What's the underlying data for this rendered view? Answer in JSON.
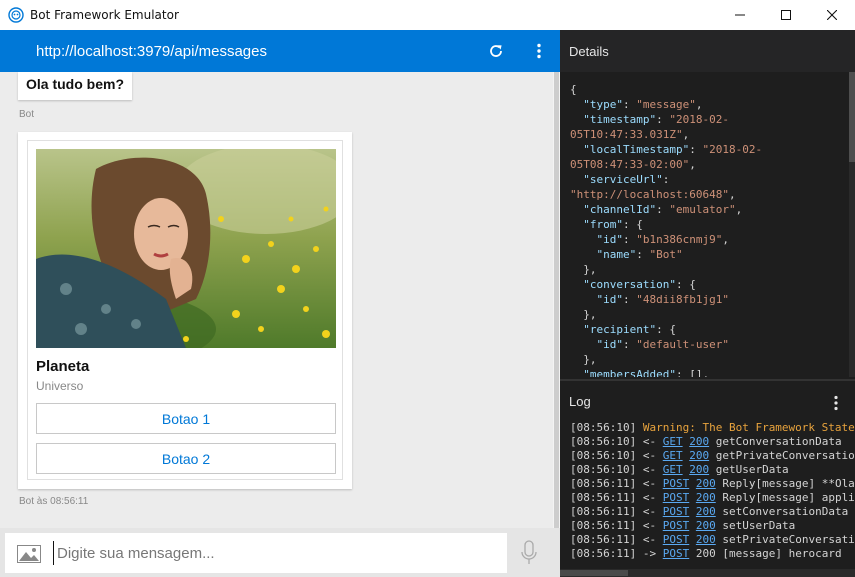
{
  "window": {
    "title": "Bot Framework Emulator"
  },
  "chat": {
    "endpoint": "http://localhost:3979/api/messages",
    "messages": [
      {
        "text": "Ola tudo bem?",
        "meta": "Bot"
      }
    ],
    "card": {
      "title": "Planeta",
      "subtitle": "Universo",
      "buttons": [
        "Botao 1",
        "Botao 2"
      ],
      "meta": "Bot às 08:56:11"
    },
    "input": {
      "placeholder": "Digite sua mensagem..."
    }
  },
  "details": {
    "title": "Details",
    "json_lines": [
      {
        "t": [
          [
            "p",
            "{"
          ]
        ]
      },
      {
        "t": [
          [
            "p",
            "  "
          ],
          [
            "k",
            "\"type\""
          ],
          [
            "p",
            ": "
          ],
          [
            "s",
            "\"message\""
          ],
          [
            "p",
            ","
          ]
        ]
      },
      {
        "t": [
          [
            "p",
            "  "
          ],
          [
            "k",
            "\"timestamp\""
          ],
          [
            "p",
            ": "
          ],
          [
            "s",
            "\"2018-02-"
          ]
        ]
      },
      {
        "t": [
          [
            "s",
            "05T10:47:33.031Z\""
          ],
          [
            "p",
            ","
          ]
        ]
      },
      {
        "t": [
          [
            "p",
            "  "
          ],
          [
            "k",
            "\"localTimestamp\""
          ],
          [
            "p",
            ": "
          ],
          [
            "s",
            "\"2018-02-"
          ]
        ]
      },
      {
        "t": [
          [
            "s",
            "05T08:47:33-02:00\""
          ],
          [
            "p",
            ","
          ]
        ]
      },
      {
        "t": [
          [
            "p",
            "  "
          ],
          [
            "k",
            "\"serviceUrl\""
          ],
          [
            "p",
            ":"
          ]
        ]
      },
      {
        "t": [
          [
            "s",
            "\"http://localhost:60648\""
          ],
          [
            "p",
            ","
          ]
        ]
      },
      {
        "t": [
          [
            "p",
            "  "
          ],
          [
            "k",
            "\"channelId\""
          ],
          [
            "p",
            ": "
          ],
          [
            "s",
            "\"emulator\""
          ],
          [
            "p",
            ","
          ]
        ]
      },
      {
        "t": [
          [
            "p",
            "  "
          ],
          [
            "k",
            "\"from\""
          ],
          [
            "p",
            ": {"
          ]
        ]
      },
      {
        "t": [
          [
            "p",
            "    "
          ],
          [
            "k",
            "\"id\""
          ],
          [
            "p",
            ": "
          ],
          [
            "s",
            "\"b1n386cnmj9\""
          ],
          [
            "p",
            ","
          ]
        ]
      },
      {
        "t": [
          [
            "p",
            "    "
          ],
          [
            "k",
            "\"name\""
          ],
          [
            "p",
            ": "
          ],
          [
            "s",
            "\"Bot\""
          ]
        ]
      },
      {
        "t": [
          [
            "p",
            "  },"
          ]
        ]
      },
      {
        "t": [
          [
            "p",
            "  "
          ],
          [
            "k",
            "\"conversation\""
          ],
          [
            "p",
            ": {"
          ]
        ]
      },
      {
        "t": [
          [
            "p",
            "    "
          ],
          [
            "k",
            "\"id\""
          ],
          [
            "p",
            ": "
          ],
          [
            "s",
            "\"48dii8fb1jg1\""
          ]
        ]
      },
      {
        "t": [
          [
            "p",
            "  },"
          ]
        ]
      },
      {
        "t": [
          [
            "p",
            "  "
          ],
          [
            "k",
            "\"recipient\""
          ],
          [
            "p",
            ": {"
          ]
        ]
      },
      {
        "t": [
          [
            "p",
            "    "
          ],
          [
            "k",
            "\"id\""
          ],
          [
            "p",
            ": "
          ],
          [
            "s",
            "\"default-user\""
          ]
        ]
      },
      {
        "t": [
          [
            "p",
            "  },"
          ]
        ]
      },
      {
        "t": [
          [
            "p",
            "  "
          ],
          [
            "k",
            "\"membersAdded\""
          ],
          [
            "p",
            ": [],"
          ]
        ]
      }
    ]
  },
  "log": {
    "title": "Log",
    "lines": [
      {
        "time": "[08:56:10]",
        "dir": "",
        "method": "",
        "status": "",
        "text": "Warning: The Bot Framework State",
        "warn": true
      },
      {
        "time": "[08:56:10]",
        "dir": "<-",
        "method": "GET",
        "status": "200",
        "text": "getConversationData"
      },
      {
        "time": "[08:56:10]",
        "dir": "<-",
        "method": "GET",
        "status": "200",
        "text": "getPrivateConversatio"
      },
      {
        "time": "[08:56:10]",
        "dir": "<-",
        "method": "GET",
        "status": "200",
        "text": "getUserData"
      },
      {
        "time": "[08:56:11]",
        "dir": "<-",
        "method": "POST",
        "status": "200",
        "text": "Reply[message] **Ola"
      },
      {
        "time": "[08:56:11]",
        "dir": "<-",
        "method": "POST",
        "status": "200",
        "text": "Reply[message] appli"
      },
      {
        "time": "[08:56:11]",
        "dir": "<-",
        "method": "POST",
        "status": "200",
        "text": "setConversationData"
      },
      {
        "time": "[08:56:11]",
        "dir": "<-",
        "method": "POST",
        "status": "200",
        "text": "setUserData"
      },
      {
        "time": "[08:56:11]",
        "dir": "<-",
        "method": "POST",
        "status": "200",
        "text": "setPrivateConversatio"
      },
      {
        "time": "[08:56:11]",
        "dir": "->",
        "method": "POST",
        "status": "200",
        "text": "[message] herocard",
        "plainStatus": true
      }
    ]
  },
  "colors": {
    "accent": "#0078d7",
    "panel_bg": "#1e1e1e",
    "warning": "#e8a33d",
    "link": "#5aa9f2"
  },
  "icons": [
    "app-icon",
    "minimize-icon",
    "maximize-icon",
    "close-icon",
    "refresh-icon",
    "more-vertical-icon",
    "image-icon",
    "microphone-icon"
  ]
}
